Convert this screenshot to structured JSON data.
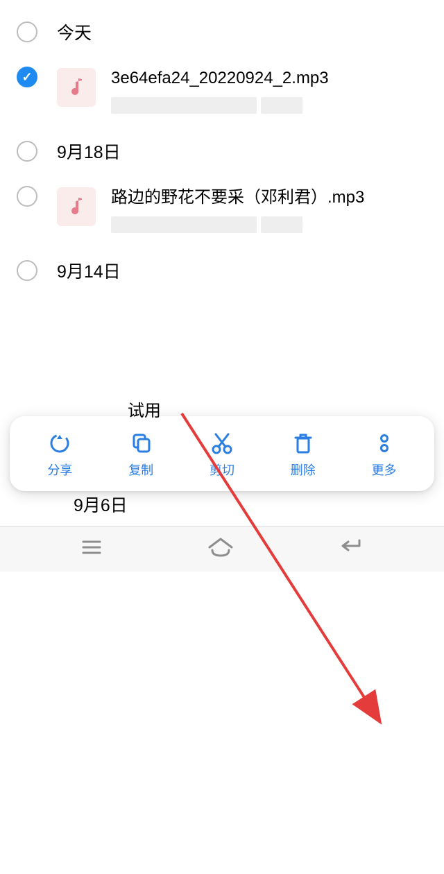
{
  "sections": {
    "today": "今天",
    "sep18": "9月18日",
    "sep14": "9月14日",
    "sep6": "9月6日"
  },
  "files": {
    "file1": "3e64efa24_20220924_2.mp3",
    "file2": "路边的野花不要采（邓利君）.mp3"
  },
  "actions": {
    "share": "分享",
    "copy": "复制",
    "cut": "剪切",
    "delete": "删除",
    "more": "更多"
  },
  "partial": "试用",
  "colors": {
    "accent": "#2a7de1",
    "checked": "#1f8bf0",
    "arrow": "#e43b3b"
  }
}
